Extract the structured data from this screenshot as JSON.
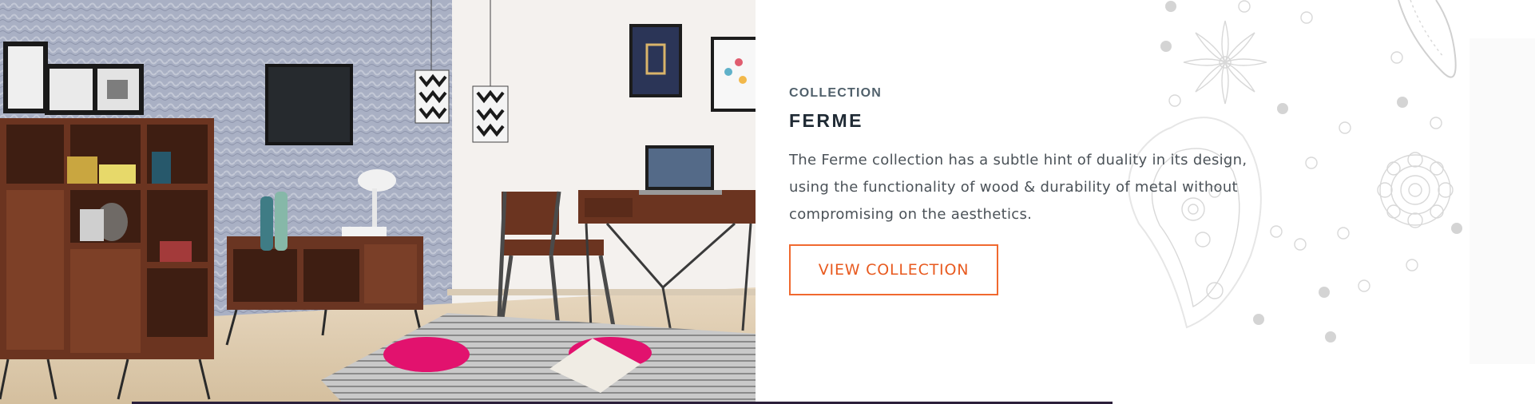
{
  "collection": {
    "eyebrow": "COLLECTION",
    "title": "FERME",
    "description": "The Ferme collection has a subtle hint of duality in its design, using the functionality of wood & durability of metal without compromising on the aesthetics.",
    "cta_label": "VIEW COLLECTION"
  },
  "colors": {
    "accent": "#f0692f",
    "heading": "#1f2a34",
    "eyebrow": "#50606b",
    "body_text": "#4b5258"
  },
  "images": {
    "hero": "living-room-furniture-photo",
    "background": "paisley-floral-pattern"
  }
}
